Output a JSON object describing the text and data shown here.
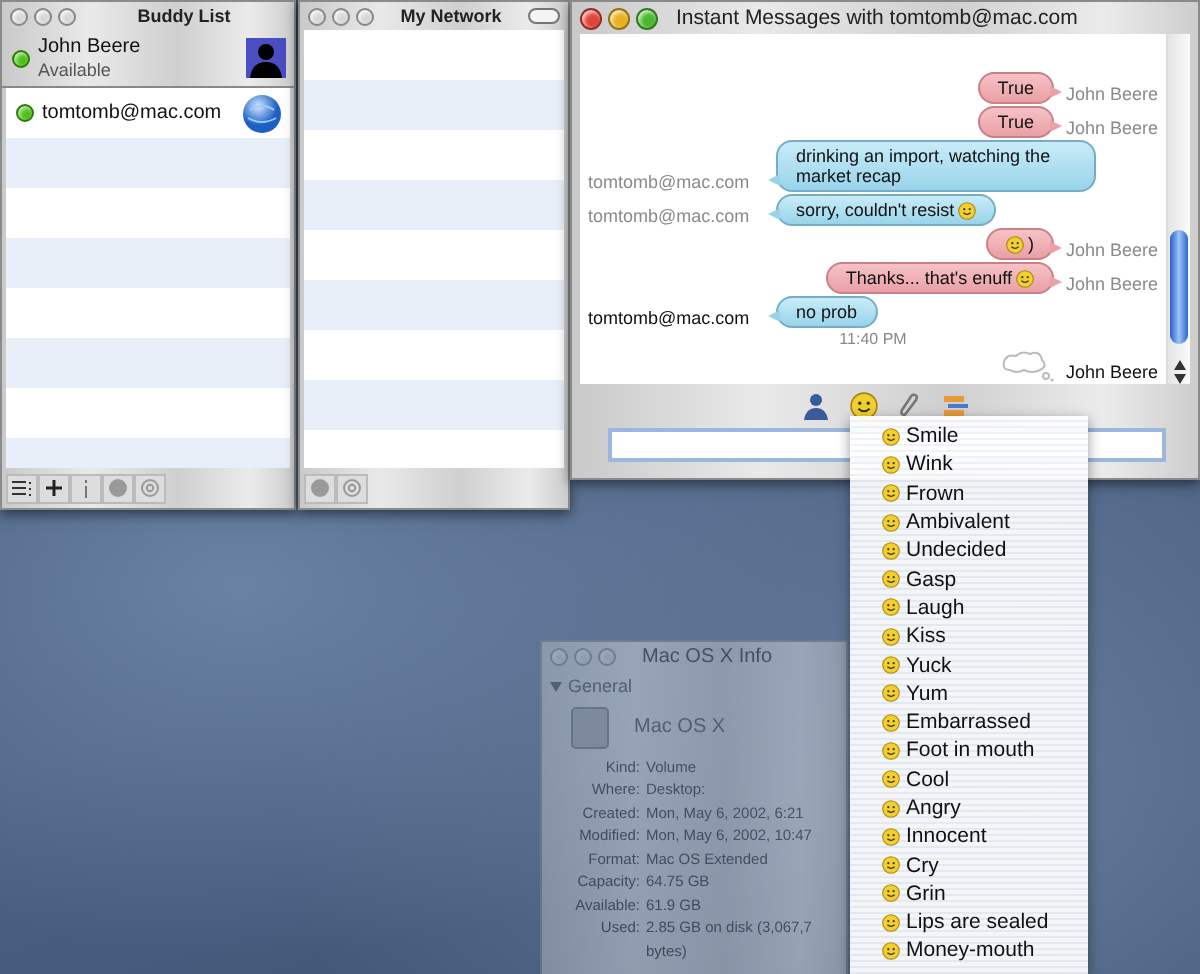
{
  "buddy_list": {
    "title": "Buddy List",
    "me": {
      "name": "John Beere",
      "status": "Available",
      "online": true
    },
    "buddies": [
      {
        "name": "tomtomb@mac.com",
        "online": true
      }
    ]
  },
  "network": {
    "title": "My Network"
  },
  "chat": {
    "title": "Instant Messages with tomtomb@mac.com",
    "messages": [
      {
        "kind": "outgoing",
        "sender": "John Beere",
        "parts": [
          {
            "kind": "text",
            "text": "True"
          }
        ],
        "recent": false
      },
      {
        "kind": "outgoing",
        "sender": "John Beere",
        "parts": [
          {
            "kind": "text",
            "text": "True"
          }
        ],
        "recent": false
      },
      {
        "kind": "incoming",
        "sender": "tomtomb@mac.com",
        "parts": [
          {
            "kind": "text",
            "text": "drinking an import, watching the market recap"
          }
        ],
        "recent": false
      },
      {
        "kind": "incoming",
        "sender": "tomtomb@mac.com",
        "parts": [
          {
            "kind": "text",
            "text": "sorry, couldn't resist"
          },
          {
            "kind": "emoticon"
          }
        ],
        "recent": false
      },
      {
        "kind": "outgoing",
        "sender": "John Beere",
        "parts": [
          {
            "kind": "emoticon"
          },
          {
            "kind": "text",
            "text": ")"
          }
        ],
        "recent": false
      },
      {
        "kind": "outgoing",
        "sender": "John Beere",
        "parts": [
          {
            "kind": "text",
            "text": "Thanks... that's enuff"
          },
          {
            "kind": "emoticon"
          }
        ],
        "recent": false
      },
      {
        "kind": "incoming",
        "sender": "tomtomb@mac.com",
        "parts": [
          {
            "kind": "text",
            "text": "no prob"
          }
        ],
        "recent": true
      },
      {
        "kind": "time",
        "text": "11:40 PM"
      },
      {
        "kind": "typing",
        "sender": "John Beere",
        "recent": true
      }
    ]
  },
  "emoticon_menu": [
    "Smile",
    "Wink",
    "Frown",
    "Ambivalent",
    "Undecided",
    "Gasp",
    "Laugh",
    "Kiss",
    "Yuck",
    "Yum",
    "Embarrassed",
    "Foot in mouth",
    "Cool",
    "Angry",
    "Innocent",
    "Cry",
    "Grin",
    "Lips are sealed",
    "Money-mouth"
  ],
  "info_window": {
    "title": "Mac OS X Info",
    "section": "General",
    "name": "Mac OS X",
    "fields": [
      {
        "label": "Kind:",
        "value": "Volume"
      },
      {
        "label": "Where:",
        "value": "Desktop:"
      },
      {
        "label": "Created:",
        "value": "Mon, May 6, 2002, 6:21"
      },
      {
        "label": "Modified:",
        "value": "Mon, May 6, 2002, 10:47"
      },
      {
        "label": "Format:",
        "value": "Mac OS Extended"
      },
      {
        "label": "Capacity:",
        "value": "64.75 GB"
      },
      {
        "label": "Available:",
        "value": "61.9 GB"
      },
      {
        "label": "Used:",
        "value": "2.85 GB on disk (3,067,7"
      },
      {
        "value": "bytes)"
      }
    ]
  }
}
